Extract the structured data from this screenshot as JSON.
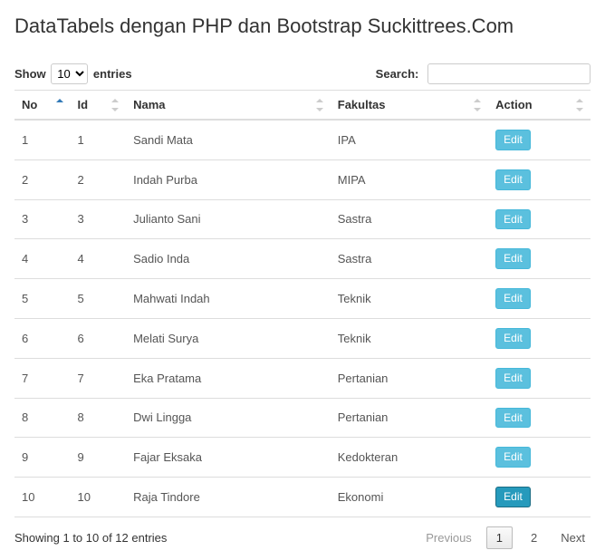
{
  "page": {
    "title": "DataTabels dengan PHP dan Bootstrap Suckittrees.Com"
  },
  "length_menu": {
    "prefix": "Show",
    "suffix": "entries",
    "selected": "10"
  },
  "search": {
    "label": "Search:",
    "value": ""
  },
  "columns": {
    "no": "No",
    "id": "Id",
    "nama": "Nama",
    "fakultas": "Fakultas",
    "action": "Action"
  },
  "rows": [
    {
      "no": "1",
      "id": "1",
      "nama": "Sandi Mata",
      "fakultas": "IPA",
      "action": "Edit"
    },
    {
      "no": "2",
      "id": "2",
      "nama": "Indah Purba",
      "fakultas": "MIPA",
      "action": "Edit"
    },
    {
      "no": "3",
      "id": "3",
      "nama": "Julianto Sani",
      "fakultas": "Sastra",
      "action": "Edit"
    },
    {
      "no": "4",
      "id": "4",
      "nama": "Sadio Inda",
      "fakultas": "Sastra",
      "action": "Edit"
    },
    {
      "no": "5",
      "id": "5",
      "nama": "Mahwati Indah",
      "fakultas": "Teknik",
      "action": "Edit"
    },
    {
      "no": "6",
      "id": "6",
      "nama": "Melati Surya",
      "fakultas": "Teknik",
      "action": "Edit"
    },
    {
      "no": "7",
      "id": "7",
      "nama": "Eka Pratama",
      "fakultas": "Pertanian",
      "action": "Edit"
    },
    {
      "no": "8",
      "id": "8",
      "nama": "Dwi Lingga",
      "fakultas": "Pertanian",
      "action": "Edit"
    },
    {
      "no": "9",
      "id": "9",
      "nama": "Fajar Eksaka",
      "fakultas": "Kedokteran",
      "action": "Edit"
    },
    {
      "no": "10",
      "id": "10",
      "nama": "Raja Tindore",
      "fakultas": "Ekonomi",
      "action": "Edit"
    }
  ],
  "info": "Showing 1 to 10 of 12 entries",
  "pagination": {
    "previous": "Previous",
    "next": "Next",
    "pages": [
      "1",
      "2"
    ],
    "current": "1"
  }
}
